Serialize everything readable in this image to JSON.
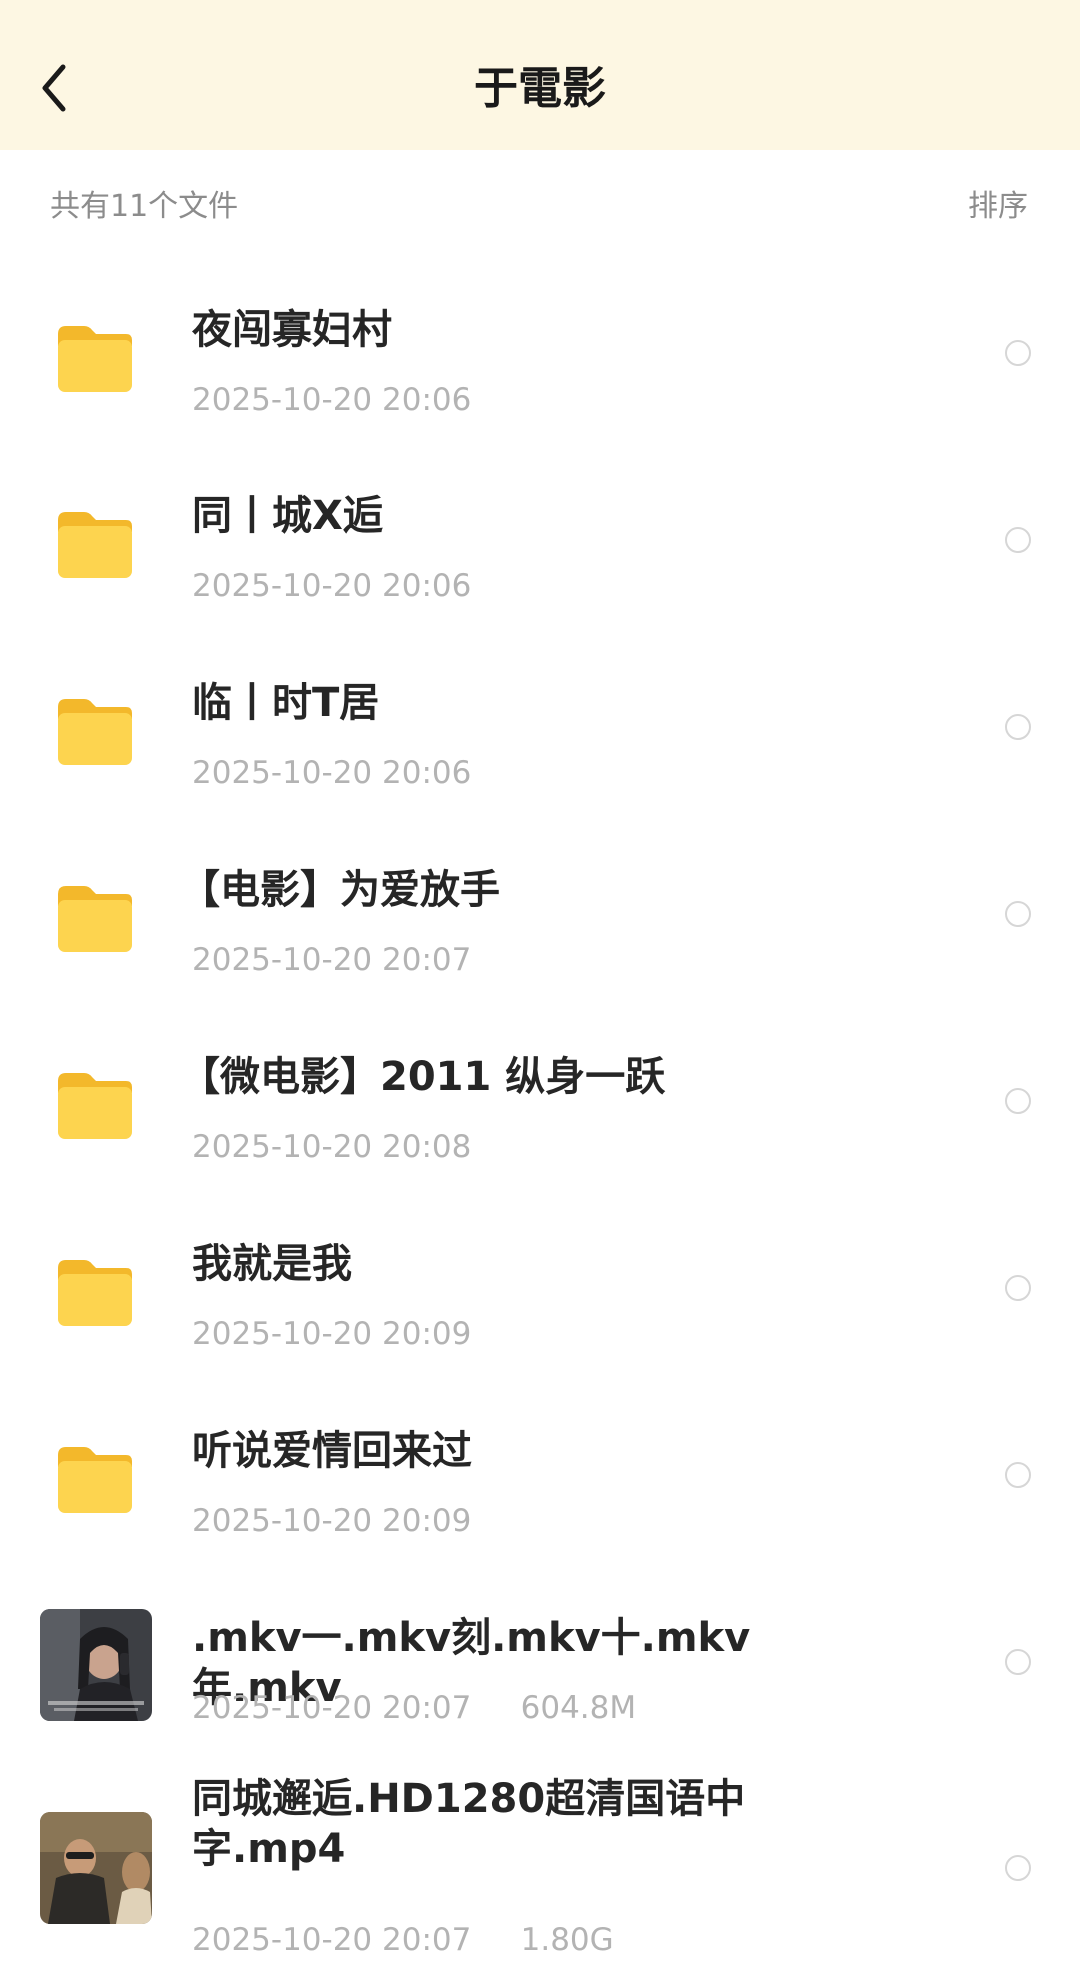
{
  "header": {
    "title": "于電影"
  },
  "toolbar": {
    "count_text": "共有11个文件",
    "sort_label": "排序"
  },
  "items": [
    {
      "type": "folder",
      "name": "夜闯寡妇村",
      "meta": "2025-10-20 20:06"
    },
    {
      "type": "folder",
      "name": "同丨城X逅",
      "meta": "2025-10-20 20:06"
    },
    {
      "type": "folder",
      "name": "临丨时T居",
      "meta": "2025-10-20 20:06"
    },
    {
      "type": "folder",
      "name": "【电影】为爱放手",
      "meta": "2025-10-20 20:07"
    },
    {
      "type": "folder",
      "name": "【微电影】2011 纵身一跃",
      "meta": "2025-10-20 20:08"
    },
    {
      "type": "folder",
      "name": "我就是我",
      "meta": "2025-10-20 20:09"
    },
    {
      "type": "folder",
      "name": "听说爱情回来过",
      "meta": "2025-10-20 20:09"
    },
    {
      "type": "video",
      "name": ".mkv一.mkv刻.mkv十.mkv年.mkv",
      "meta": "2025-10-20 20:07     604.8M"
    },
    {
      "type": "video",
      "name": "同城邂逅.HD1280超清国语中字.mp4",
      "meta": "2025-10-20 20:07     1.80G"
    }
  ],
  "colors": {
    "header_bg": "#fdf7e3",
    "folder": "#fbc93a",
    "muted_text": "#b3b3b3"
  },
  "icons": {
    "back": "chevron-left-icon",
    "folder": "folder-icon",
    "select": "radio-circle-icon"
  }
}
